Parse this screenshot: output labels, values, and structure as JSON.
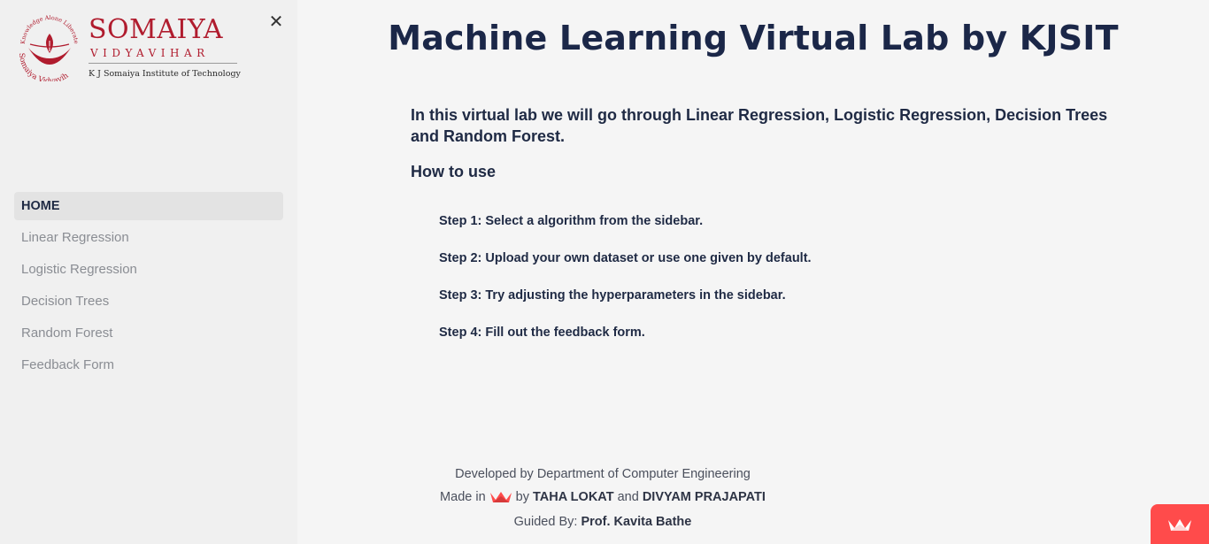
{
  "sidebar": {
    "logo": {
      "emblem_text": "Knowledge Alone Liberates",
      "emblem_bottom": "Somaiya Vidyavihar",
      "name": "SOMAIYA",
      "subtitle": "VIDYAVIHAR",
      "institute": "K J Somaiya Institute of Technology"
    },
    "close_symbol": "✕",
    "items": [
      {
        "label": "HOME"
      },
      {
        "label": "Linear Regression"
      },
      {
        "label": "Logistic Regression"
      },
      {
        "label": "Decision Trees"
      },
      {
        "label": "Random Forest"
      },
      {
        "label": "Feedback Form"
      }
    ]
  },
  "main": {
    "title": "Machine Learning Virtual Lab by KJSIT",
    "intro": "In this virtual lab we will go through Linear Regression, Logistic Regression, Decision Trees and Random Forest.",
    "howto": "How to use",
    "steps": [
      {
        "label": "Step 1: Select a algorithm from the sidebar."
      },
      {
        "label": "Step 2: Upload your own dataset or use one given by default."
      },
      {
        "label": "Step 3: Try adjusting the hyperparameters in the sidebar."
      },
      {
        "label": "Step 4: Fill out the feedback form."
      }
    ]
  },
  "footer": {
    "line1": "Developed by Department of Computer Engineering",
    "made_in": "Made in",
    "by": "by",
    "author1": "TAHA LOKAT",
    "and": "and",
    "author2": "DIVYAM PRAJAPATI",
    "guided_label": "Guided By:",
    "guide": "Prof. Kavita Bathe"
  },
  "icons": {
    "close": "close-icon",
    "crown": "streamlit-crown-icon"
  },
  "colors": {
    "brand_red": "#b01c2e",
    "streamlit_red": "#ff4b4b",
    "text_dark": "#1f2a44"
  }
}
